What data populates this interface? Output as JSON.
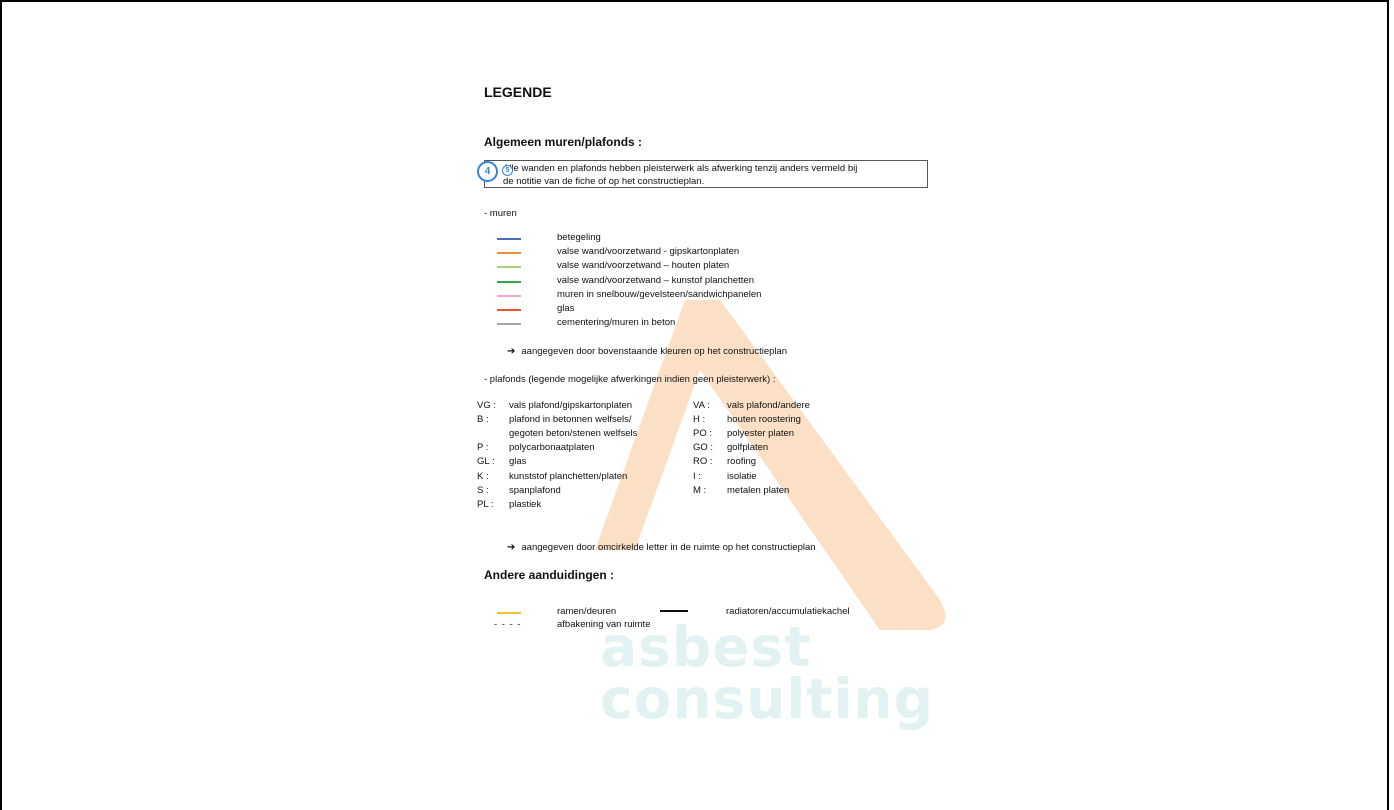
{
  "legend": {
    "title": "LEGENDE",
    "general_heading": "Algemeen muren/plafonds :",
    "badge_4": "4",
    "badge_5": "5",
    "note_line1": "Alle wanden en plafonds hebben pleisterwerk als afwerking tenzij anders vermeld bij",
    "note_line2": "de notitie van de fiche of op het constructieplan.",
    "walls_heading": "- muren",
    "walls": [
      {
        "label": "betegeling",
        "color": "#4a6fb3"
      },
      {
        "label": "valse wand/voorzetwand - gipskartonplaten",
        "color": "#ed8b3e"
      },
      {
        "label": "valse wand/voorzetwand – houten platen",
        "color": "#a8d07f"
      },
      {
        "label": "valse wand/voorzetwand – kunstof planchetten",
        "color": "#2faa4a"
      },
      {
        "label": "muren in snelbouw/gevelsteen/sandwichpanelen",
        "color": "#f4a7d6"
      },
      {
        "label": "glas",
        "color": "#e8533a"
      },
      {
        "label": "cementering/muren in beton",
        "color": "#a5a5a5"
      }
    ],
    "walls_note": "aangegeven door bovenstaande kleuren op het constructieplan",
    "ceilings_heading": "- plafonds (legende mogelijke afwerkingen indien geen pleisterwerk) :",
    "ceilings_left": [
      {
        "code": "VG :",
        "label": "vals plafond/gipskartonplaten"
      },
      {
        "code": "B :",
        "label": "plafond in betonnen welfsels/"
      },
      {
        "code": "",
        "label": "gegoten beton/stenen welfsels"
      },
      {
        "code": "P :",
        "label": "polycarbonaatplaten"
      },
      {
        "code": "GL :",
        "label": "glas"
      },
      {
        "code": "K :",
        "label": "kunststof planchetten/platen"
      },
      {
        "code": "S :",
        "label": "spanplafond"
      },
      {
        "code": "PL :",
        "label": "plastiek"
      }
    ],
    "ceilings_right": [
      {
        "code": "VA :",
        "label": "vals plafond/andere"
      },
      {
        "code": "H :",
        "label": "houten roostering"
      },
      {
        "code": "PO :",
        "label": "polyester platen"
      },
      {
        "code": "GO :",
        "label": "golfplaten"
      },
      {
        "code": "RO :",
        "label": "roofing"
      },
      {
        "code": "I :",
        "label": "isolatie"
      },
      {
        "code": "M :",
        "label": "metalen platen"
      }
    ],
    "ceilings_note": "aangegeven door omcirkelde letter in de ruimte op het constructieplan",
    "other_heading": "Andere aanduidingen :",
    "other_windows": "ramen/deuren",
    "other_windows_color": "#f2c230",
    "other_radiators": "radiatoren/accumulatiekachel",
    "other_dashed_symbol": "- - - -",
    "other_boundary": "afbakening van ruimte",
    "arrow_glyph": "➔"
  },
  "watermark": {
    "line1": "asbest",
    "line2": "consulting",
    "shape_color": "#fbe0c6",
    "text_color": "#e2f1f1"
  }
}
